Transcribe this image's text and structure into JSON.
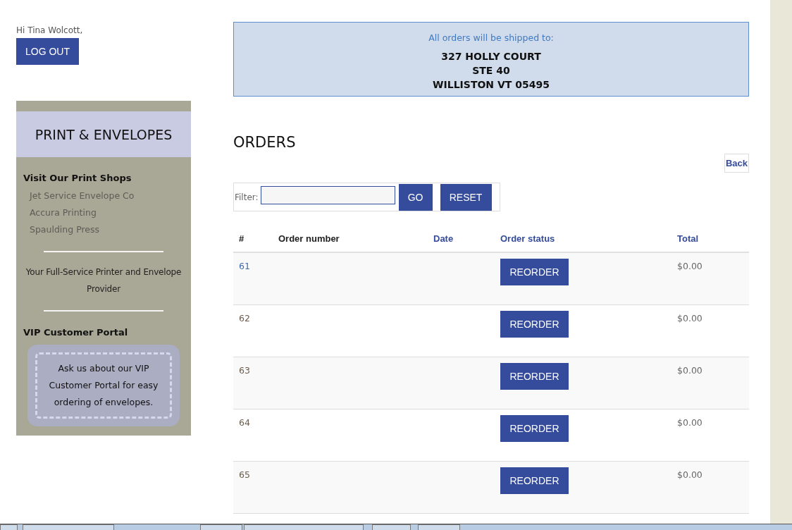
{
  "greeting": "Hi Tina Wolcott,",
  "logout_button": "LOG OUT",
  "sidebar": {
    "title": "PRINT & ENVELOPES",
    "shops_heading": "Visit Our Print Shops",
    "shops": [
      "Jet Service Envelope Co",
      "Accura Printing",
      "Spaulding Press"
    ],
    "tagline": "Your Full-Service Printer and Envelope Provider",
    "vip_heading": "VIP Customer Portal",
    "vip_text": "Ask us about our VIP Customer Portal for easy ordering of envelopes."
  },
  "shipping": {
    "label": "All orders will be shipped to:",
    "address_lines": [
      "327 HOLLY COURT",
      "STE 40",
      "WILLISTON VT 05495"
    ]
  },
  "page_title": "ORDERS",
  "back_link": "Back",
  "filter": {
    "label": "Filter:",
    "go_button": "GO",
    "reset_button": "RESET"
  },
  "table": {
    "columns": [
      {
        "label": "#",
        "sortable": false
      },
      {
        "label": "Order number",
        "sortable": false
      },
      {
        "label": "Date",
        "sortable": true
      },
      {
        "label": "Order status",
        "sortable": true
      },
      {
        "label": "Total",
        "sortable": true
      }
    ],
    "rows": [
      {
        "number": "61",
        "action": "REORDER",
        "total": "$0.00",
        "highlighted": true
      },
      {
        "number": "62",
        "action": "REORDER",
        "total": "$0.00",
        "highlighted": false
      },
      {
        "number": "63",
        "action": "REORDER",
        "total": "$0.00",
        "highlighted": false
      },
      {
        "number": "64",
        "action": "REORDER",
        "total": "$0.00",
        "highlighted": false
      },
      {
        "number": "65",
        "action": "REORDER",
        "total": "$0.00",
        "highlighted": false
      }
    ]
  }
}
